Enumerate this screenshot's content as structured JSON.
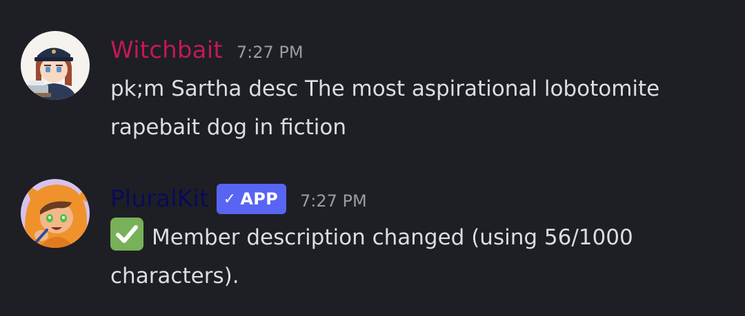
{
  "messages": [
    {
      "username": "Witchbait",
      "username_color": "#c2185b",
      "timestamp": "7:27 PM",
      "text": "pk;m Sartha desc The most aspirational lobotomite rapebait dog in fiction",
      "avatar_icon": "avatar-witchbait"
    },
    {
      "username": "PluralKit",
      "username_color": "#0a0a5a",
      "badge": {
        "label": "APP",
        "icon": "checkmark-icon",
        "color": "#5865f2"
      },
      "timestamp": "7:27 PM",
      "emoji": "white-check-mark-icon",
      "emoji_color": "#78b159",
      "text": "Member description changed (using 56/1000 characters).",
      "avatar_icon": "avatar-pluralkit"
    }
  ],
  "theme": {
    "background": "#1e1f24",
    "text": "#dbdee1",
    "muted": "#9a9ca4"
  }
}
